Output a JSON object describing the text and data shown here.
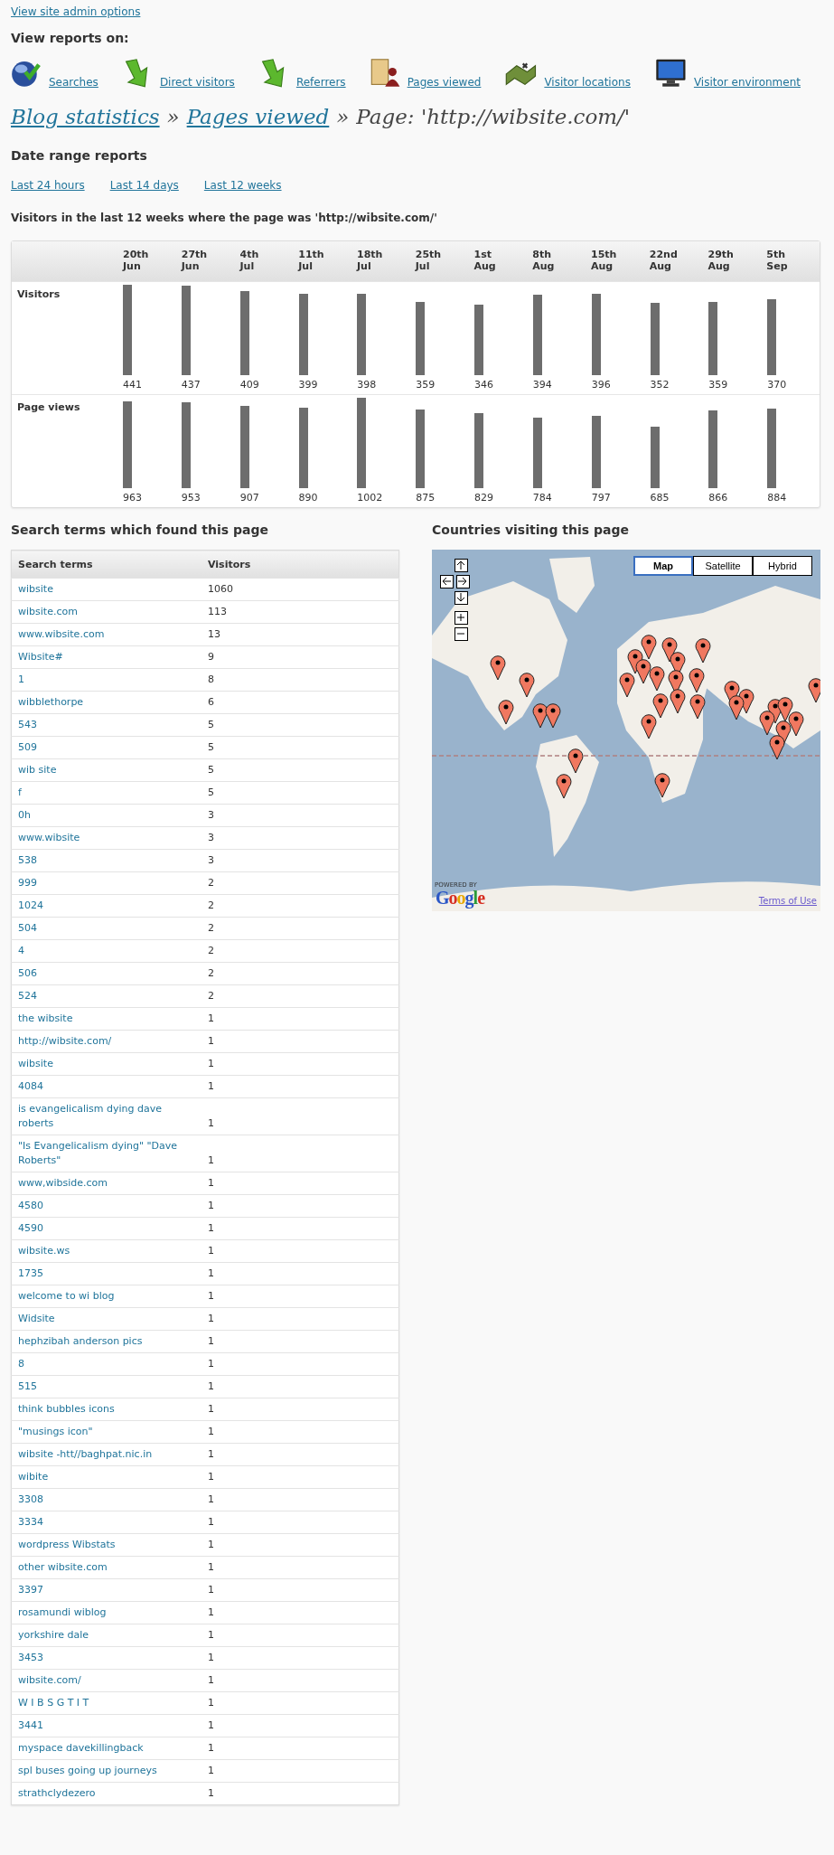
{
  "admin_link": "View site admin options",
  "reports_heading": "View reports on:",
  "report_links": [
    {
      "kind": "searches",
      "label": "Searches"
    },
    {
      "kind": "direct",
      "label": "Direct visitors"
    },
    {
      "kind": "referrers",
      "label": "Referrers"
    },
    {
      "kind": "pages",
      "label": "Pages viewed"
    },
    {
      "kind": "locations",
      "label": "Visitor locations"
    },
    {
      "kind": "environment",
      "label": "Visitor environment"
    }
  ],
  "breadcrumb": [
    {
      "kind": "link",
      "text": "Blog statistics"
    },
    {
      "kind": "separator",
      "text": "»"
    },
    {
      "kind": "link",
      "text": "Pages viewed"
    },
    {
      "kind": "separator",
      "text": "»"
    },
    {
      "kind": "current",
      "text": "Page: 'http://wibsite.com/'"
    }
  ],
  "date_range": {
    "heading": "Date range reports",
    "links": [
      "Last 24 hours",
      "Last 14 days",
      "Last 12 weeks"
    ]
  },
  "weekly": {
    "title": "Visitors in the last 12 weeks where the page was 'http://wibsite.com/'",
    "columns": [
      "20th Jun",
      "27th Jun",
      "4th Jul",
      "11th Jul",
      "18th Jul",
      "25th Jul",
      "1st Aug",
      "8th Aug",
      "15th Aug",
      "22nd Aug",
      "29th Aug",
      "5th Sep"
    ],
    "rows": [
      {
        "label": "Visitors",
        "cells": [
          "441",
          "437",
          "409",
          "399",
          "398",
          "359",
          "346",
          "394",
          "396",
          "352",
          "359",
          "370"
        ]
      },
      {
        "label": "Page views",
        "cells": [
          "963",
          "953",
          "907",
          "890",
          "1002",
          "875",
          "829",
          "784",
          "797",
          "685",
          "866",
          "884"
        ]
      }
    ]
  },
  "search_terms": {
    "title": "Search terms which found this page",
    "columns": [
      "Search terms",
      "Visitors"
    ],
    "rows": [
      {
        "term": "wibsite",
        "visitors": "1060"
      },
      {
        "term": "wibsite.com",
        "visitors": "113"
      },
      {
        "term": "www.wibsite.com",
        "visitors": "13"
      },
      {
        "term": "Wibsite#",
        "visitors": "9"
      },
      {
        "term": "1",
        "visitors": "8"
      },
      {
        "term": "wibblethorpe",
        "visitors": "6"
      },
      {
        "term": "543",
        "visitors": "5"
      },
      {
        "term": "509",
        "visitors": "5"
      },
      {
        "term": "wib site",
        "visitors": "5"
      },
      {
        "term": "f",
        "visitors": "5"
      },
      {
        "term": "0h",
        "visitors": "3"
      },
      {
        "term": "www.wibsite",
        "visitors": "3"
      },
      {
        "term": "538",
        "visitors": "3"
      },
      {
        "term": "999",
        "visitors": "2"
      },
      {
        "term": "1024",
        "visitors": "2"
      },
      {
        "term": "504",
        "visitors": "2"
      },
      {
        "term": "4",
        "visitors": "2"
      },
      {
        "term": "506",
        "visitors": "2"
      },
      {
        "term": "524",
        "visitors": "2"
      },
      {
        "term": "the wibsite",
        "visitors": "1"
      },
      {
        "term": "http://wibsite.com/",
        "visitors": "1"
      },
      {
        "term": "wibsite",
        "visitors": "1"
      },
      {
        "term": "4084",
        "visitors": "1"
      },
      {
        "term": "is evangelicalism dying dave roberts",
        "visitors": "1"
      },
      {
        "term": "\"Is Evangelicalism dying\" \"Dave Roberts\"",
        "visitors": "1"
      },
      {
        "term": "www,wibside.com",
        "visitors": "1"
      },
      {
        "term": "4580",
        "visitors": "1"
      },
      {
        "term": "4590",
        "visitors": "1"
      },
      {
        "term": "wibsite.ws",
        "visitors": "1"
      },
      {
        "term": "1735",
        "visitors": "1"
      },
      {
        "term": "welcome to wi blog",
        "visitors": "1"
      },
      {
        "term": "Widsite",
        "visitors": "1"
      },
      {
        "term": "hephzibah anderson pics",
        "visitors": "1"
      },
      {
        "term": "8",
        "visitors": "1"
      },
      {
        "term": "515",
        "visitors": "1"
      },
      {
        "term": "think bubbles icons",
        "visitors": "1"
      },
      {
        "term": "\"musings icon\"",
        "visitors": "1"
      },
      {
        "term": "wibsite -htt//baghpat.nic.in",
        "visitors": "1"
      },
      {
        "term": "wibite",
        "visitors": "1"
      },
      {
        "term": "3308",
        "visitors": "1"
      },
      {
        "term": "3334",
        "visitors": "1"
      },
      {
        "term": "wordpress Wibstats",
        "visitors": "1"
      },
      {
        "term": "other wibsite.com",
        "visitors": "1"
      },
      {
        "term": "3397",
        "visitors": "1"
      },
      {
        "term": "rosamundi wiblog",
        "visitors": "1"
      },
      {
        "term": "yorkshire dale",
        "visitors": "1"
      },
      {
        "term": "3453",
        "visitors": "1"
      },
      {
        "term": "wibsite.com/",
        "visitors": "1"
      },
      {
        "term": "W I B S G T I T",
        "visitors": "1"
      },
      {
        "term": "3441",
        "visitors": "1"
      },
      {
        "term": "myspace davekillingback",
        "visitors": "1"
      },
      {
        "term": "spl buses going up journeys",
        "visitors": "1"
      },
      {
        "term": "strathclydezero",
        "visitors": "1"
      }
    ]
  },
  "countries": {
    "title": "Countries visiting this page",
    "map": {
      "kind": "picture",
      "map_types": [
        {
          "label": "Map",
          "selected": true
        },
        {
          "label": "Satellite",
          "selected": false
        },
        {
          "label": "Hybrid",
          "selected": false
        }
      ],
      "powered_by": "POWERED BY",
      "logo": "Google",
      "terms_link": "Terms of Use"
    }
  }
}
